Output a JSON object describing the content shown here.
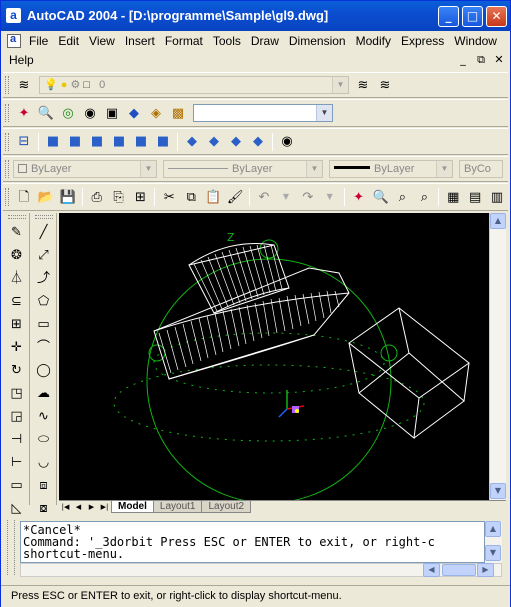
{
  "window": {
    "title": "AutoCAD 2004 - [D:\\programme\\Sample\\gl9.dwg]",
    "app_icon": "autocad-icon"
  },
  "menu": {
    "items": [
      "File",
      "Edit",
      "View",
      "Insert",
      "Format",
      "Tools",
      "Draw",
      "Dimension",
      "Modify",
      "Express",
      "Window"
    ],
    "items_row2": [
      "Help"
    ]
  },
  "layers_toolbar": {
    "layer_value": "0"
  },
  "properties_toolbar": {
    "color": "ByLayer",
    "linetype": "ByLayer",
    "lineweight": "ByLayer",
    "plotstyle": "ByCo"
  },
  "drawing": {
    "ucs_axis_label": "Z",
    "colors": {
      "background": "#000000",
      "orbit": "#13b313",
      "geometry": "#ffffff"
    }
  },
  "tabs": {
    "items": [
      "Model",
      "Layout1",
      "Layout2"
    ],
    "active": "Model"
  },
  "command": {
    "line1": "*Cancel*",
    "line2": "Command: '_3dorbit Press ESC or ENTER to exit, or right-c",
    "line3": "shortcut-menu."
  },
  "status": {
    "text": "Press ESC or ENTER to exit, or right-click to display shortcut-menu."
  }
}
